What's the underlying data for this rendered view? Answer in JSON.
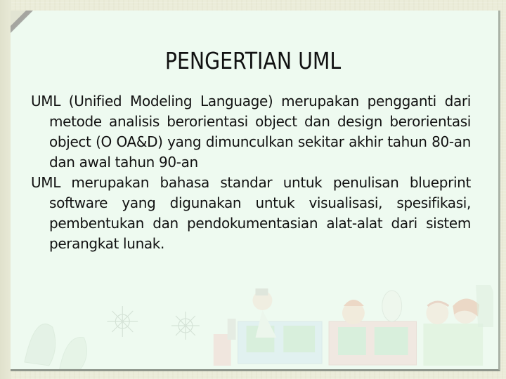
{
  "slide": {
    "title": "PENGERTIAN UML",
    "paragraphs": [
      "UML (Unified Modeling Language) merupakan pengganti dari metode analisis berorientasi object dan design berorientasi object (O OA&D) yang dimunculkan sekitar akhir tahun 80-an dan awal tahun 90-an",
      "UML merupakan bahasa standar untuk penulisan blueprint software yang digunakan untuk visualisasi, spesifikasi, pembentukan dan pendokumentasian alat-alat dari sistem perangkat lunak."
    ]
  },
  "theme": {
    "background": "#ebecd9",
    "paper": "#eefaf0",
    "paper_border": "#8e958b",
    "text": "#111111",
    "corner_fold": "#9a9a96"
  },
  "decoration": {
    "illustration": "cartoon-train-with-passengers"
  }
}
